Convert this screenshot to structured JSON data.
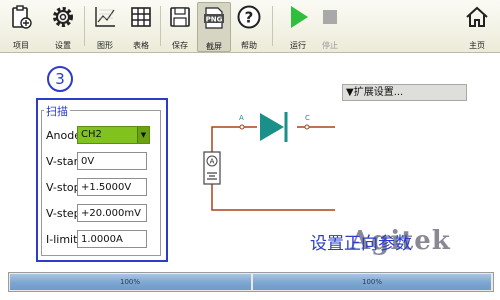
{
  "toolbar": {
    "project_label": "项目",
    "settings_label": "设置",
    "graph_label": "图形",
    "table_label": "表格",
    "save_label": "保存",
    "screenshot_label": "截屏",
    "screenshot_icon_text": "PNG",
    "help_label": "帮助",
    "run_label": "运行",
    "stop_label": "停止",
    "home_label": "主页"
  },
  "step_marker": "3",
  "scan": {
    "title": "扫描",
    "anode_label": "Anode",
    "anode_value": "CH2",
    "vstart_label": "V-start",
    "vstart_value": "0V",
    "vstop_label": "V-stop",
    "vstop_value": "+1.5000V",
    "vstep_label": "V-step",
    "vstep_value": "+20.000mV",
    "ilimit_label": "I-limit",
    "ilimit_value": "1.0000A"
  },
  "expand_settings": "▼扩展设置...",
  "circuit": {
    "node_a": "A",
    "node_c": "C",
    "meter_label": "A"
  },
  "overlay_text": "设置正向参数",
  "watermark": "Agitek",
  "progress": {
    "bar1_text": "100%",
    "bar2_text": "100%",
    "bar1_fraction": 1.0,
    "bar2_fraction": 1.0
  },
  "colors": {
    "accent_blue": "#2a3cc8",
    "select_green": "#82c21e",
    "run_green": "#2fbf3a",
    "diode_teal": "#1b8f8a",
    "wire_brown": "#a8441c"
  }
}
